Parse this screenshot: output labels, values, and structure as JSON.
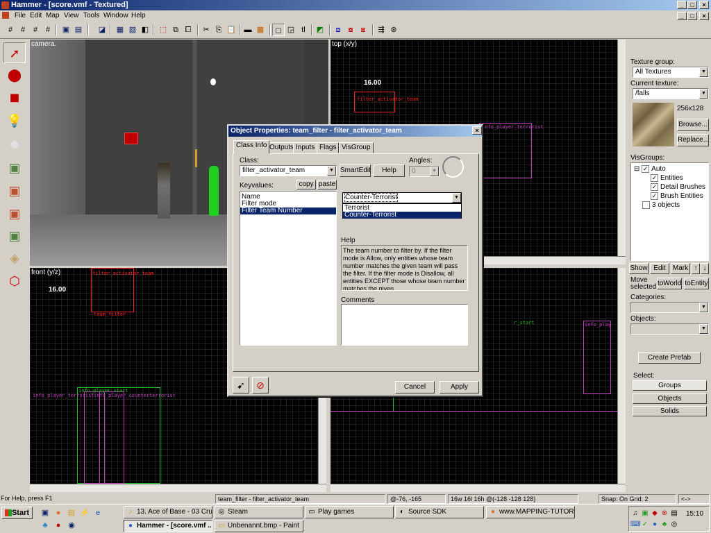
{
  "window": {
    "title": "Hammer - [score.vmf - Textured]"
  },
  "menu": [
    "File",
    "Edit",
    "Map",
    "View",
    "Tools",
    "Window",
    "Help"
  ],
  "viewports": {
    "camera": {
      "label": "camera."
    },
    "top": {
      "label": "top (x/y)",
      "size_label": "16.00",
      "entity1": "filter_activator_team",
      "entity2": "info_player_terrorist"
    },
    "front": {
      "label": "front (y/z)",
      "size_label": "16.00",
      "entity1": "filter_activator_team",
      "entity2": "team_filter",
      "entity3": "info_player_start",
      "entity4": "info_player_terrorist",
      "entity5": "info_player_counterterrorist"
    },
    "side": {
      "entity1": "info_player_start",
      "entity2": "info_player_terrorist"
    }
  },
  "right_panel": {
    "texture_group_label": "Texture group:",
    "texture_group_value": "All Textures",
    "current_texture_label": "Current texture:",
    "current_texture_value": "/falls",
    "texture_size": "256x128",
    "browse": "Browse...",
    "replace": "Replace...",
    "visgroups_label": "VisGroups:",
    "visgroups": [
      {
        "label": "Auto"
      },
      {
        "label": "Entities"
      },
      {
        "label": "Detail Brushes"
      },
      {
        "label": "Brush Entities"
      },
      {
        "label": "3 objects"
      }
    ],
    "show": "Show",
    "edit": "Edit",
    "mark": "Mark",
    "move_selected_label": "Move selected:",
    "to_world": "toWorld",
    "to_entity": "toEntity",
    "categories_label": "Categories:",
    "objects_label": "Objects:",
    "create_prefab": "Create Prefab",
    "select_label": "Select:",
    "groups": "Groups",
    "objects": "Objects",
    "solids": "Solids"
  },
  "dialog": {
    "title": "Object Properties: team_filter - filter_activator_team",
    "tabs": [
      "Class Info",
      "Outputs",
      "Inputs",
      "Flags",
      "VisGroup"
    ],
    "class_label": "Class:",
    "class_value": "filter_activator_team",
    "smartedit": "SmartEdit",
    "help_button": "Help",
    "angles_label": "Angles:",
    "angles_value": "0",
    "keyvalues_label": "Keyvalues:",
    "copy": "copy",
    "paste": "paste",
    "keyvalues": [
      "Name",
      "Filter mode",
      "Filter Team Number"
    ],
    "team_value": "Counter-Terrorist",
    "team_options": [
      "Terrorist",
      "Counter-Terrorist"
    ],
    "help_label": "Help",
    "help_text": "The team number to filter by.  If the filter mode is Allow, only entities whose team number matches the given team will pass the filter. If the filter mode is Disallow, all entities EXCEPT those whose team number matches the given",
    "comments_label": "Comments",
    "cancel": "Cancel",
    "apply": "Apply"
  },
  "status_bar": {
    "help": "For Help, press F1",
    "selection": "team_filter - filter_activator_team",
    "coords": "@-76, -165",
    "size": "16w 16l 16h @(-128 -128 128)",
    "snap": "Snap: On Grid: 2",
    "extra": "<->"
  },
  "taskbar": {
    "start": "Start",
    "tasks": [
      "13. Ace of Base - 03 Crue...",
      "Steam",
      "Play games",
      "Source SDK",
      "www.MAPPING-TUTORIA...",
      "Hammer - [score.vmf ...",
      "Unbenannt.bmp - Paint"
    ],
    "clock": "15:10"
  }
}
